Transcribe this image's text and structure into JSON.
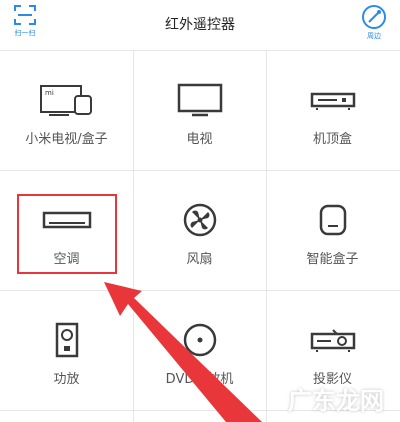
{
  "header": {
    "title": "红外遥控器",
    "scan_label": "扫一扫",
    "nearby_label": "周边"
  },
  "devices": [
    {
      "label": "小米电视/盒子",
      "icon": "mi-tv-box-icon"
    },
    {
      "label": "电视",
      "icon": "tv-icon"
    },
    {
      "label": "机顶盒",
      "icon": "set-top-box-icon"
    },
    {
      "label": "空调",
      "icon": "air-conditioner-icon"
    },
    {
      "label": "风扇",
      "icon": "fan-icon"
    },
    {
      "label": "智能盒子",
      "icon": "smart-box-icon"
    },
    {
      "label": "功放",
      "icon": "amplifier-icon"
    },
    {
      "label": "DVD播放机",
      "icon": "dvd-player-icon"
    },
    {
      "label": "投影仪",
      "icon": "projector-icon"
    }
  ],
  "annotation": {
    "highlight_color": "#e8363a",
    "highlighted_item": "空调"
  },
  "watermark": "广东龙网",
  "colors": {
    "accent": "#2b8be6",
    "icon": "#3a3a3a"
  }
}
